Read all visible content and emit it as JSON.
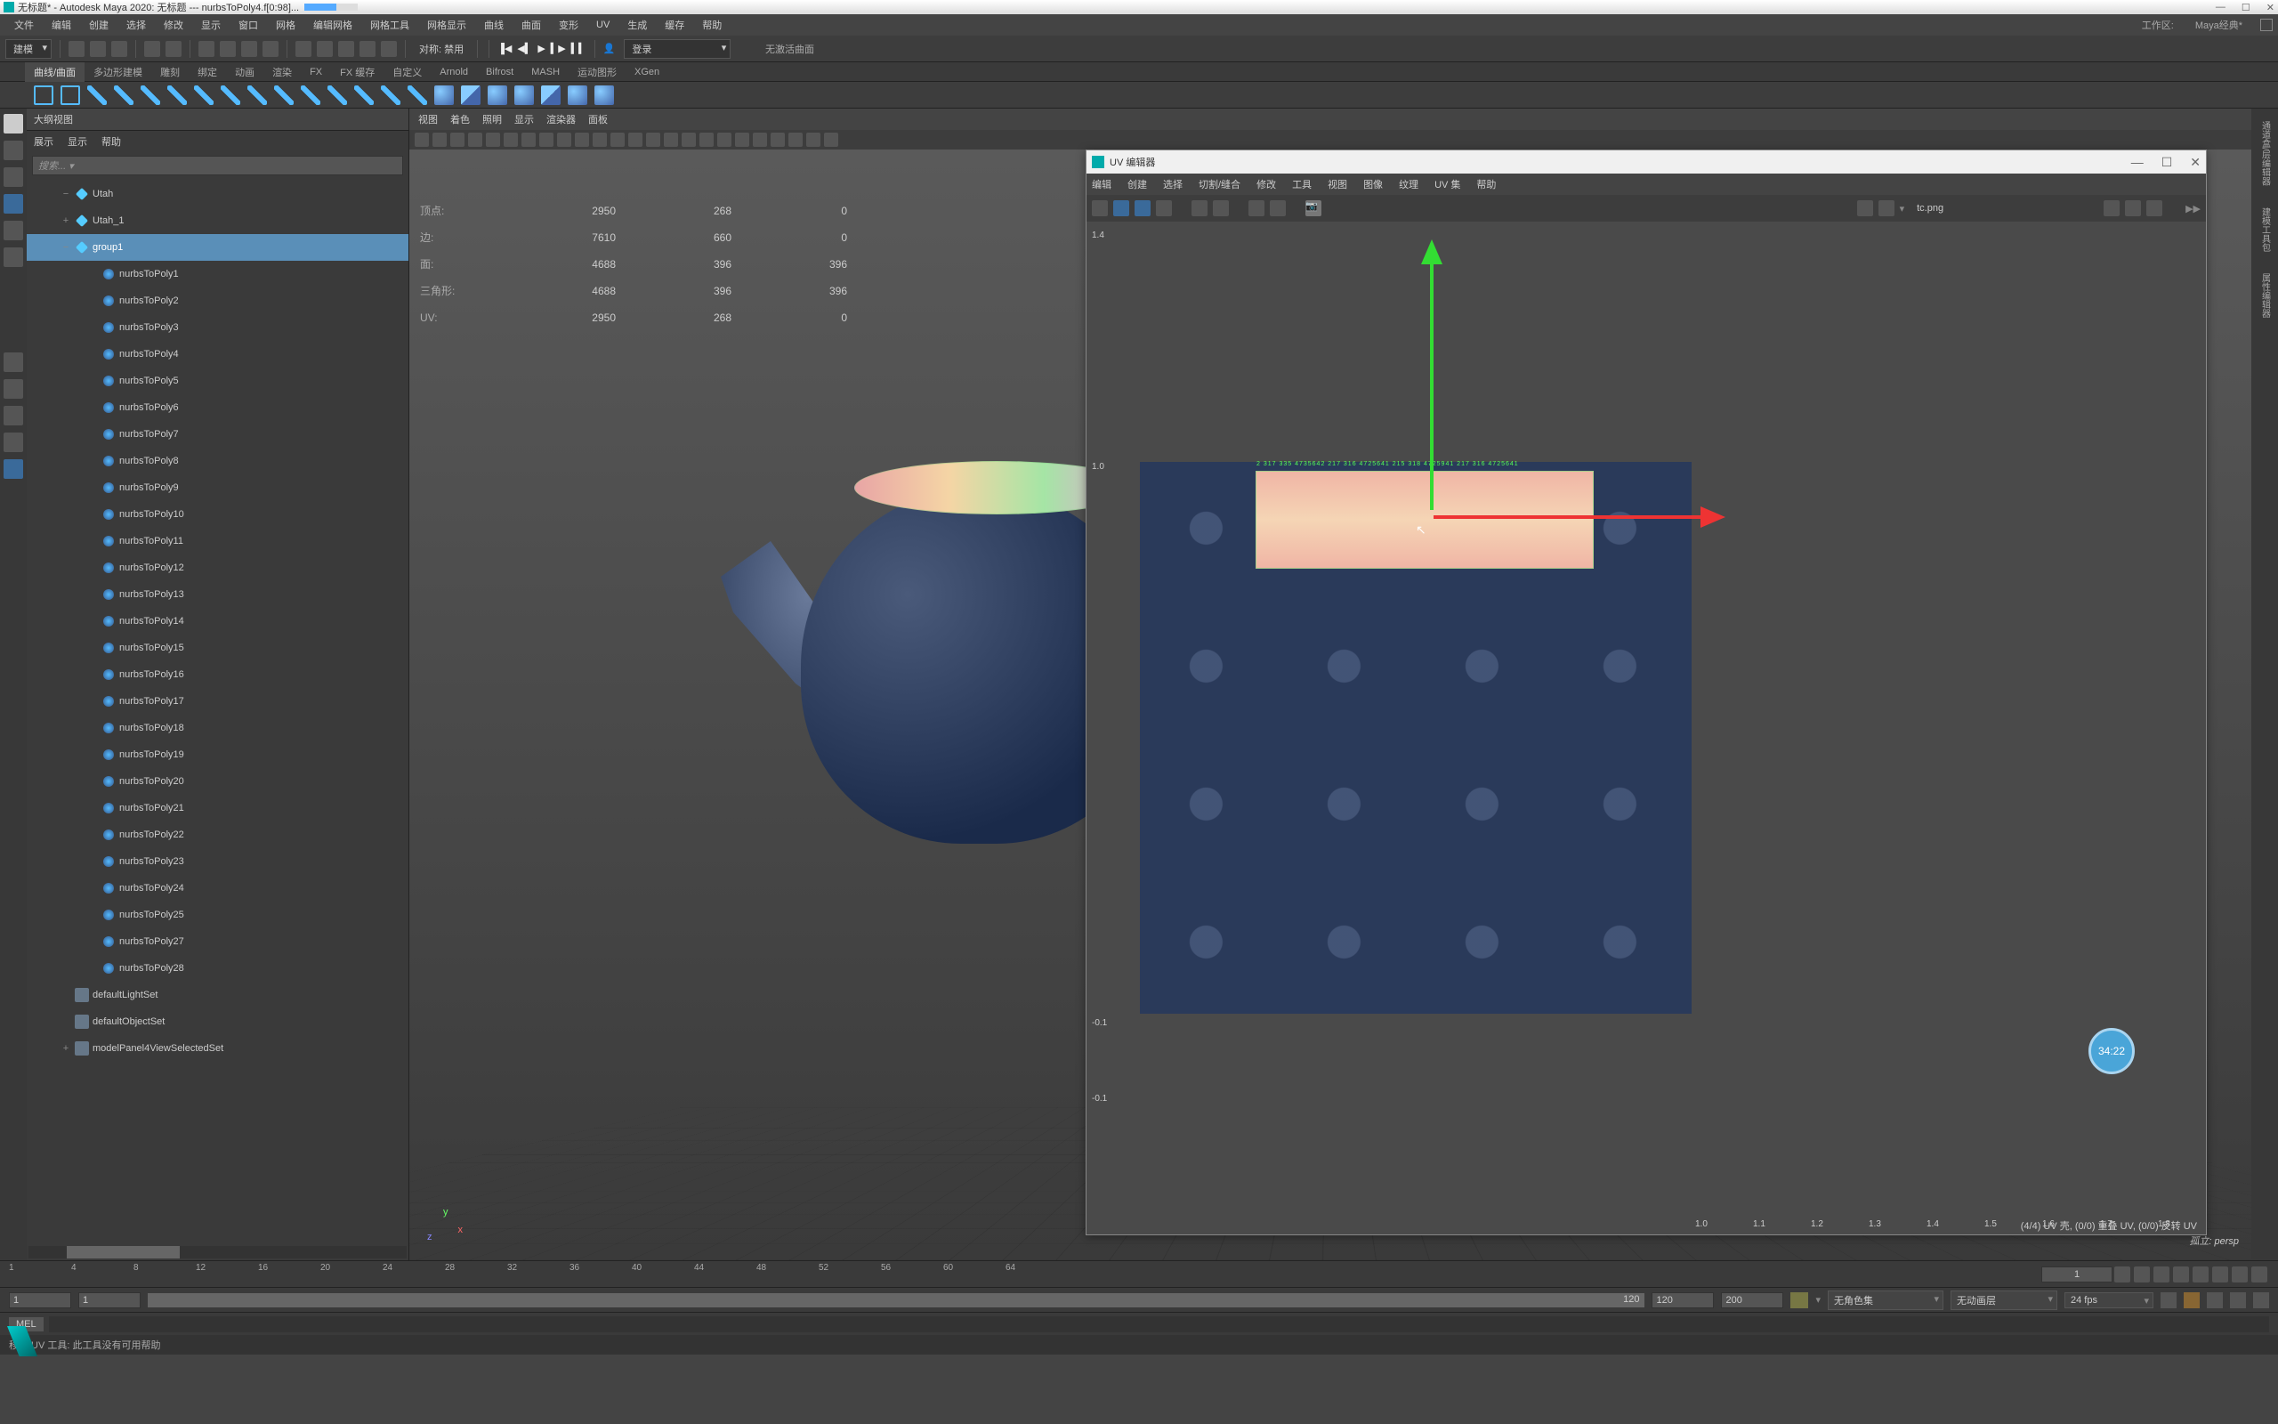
{
  "title": "无标题* - Autodesk Maya 2020: 无标题 --- nurbsToPoly4.f[0:98]...",
  "window_buttons": [
    "—",
    "☐",
    "✕"
  ],
  "workspace_label": "工作区:",
  "workspace_value": "Maya经典*",
  "menubar": [
    "文件",
    "编辑",
    "创建",
    "选择",
    "修改",
    "显示",
    "窗口",
    "网格",
    "编辑网格",
    "网格工具",
    "网格显示",
    "曲线",
    "曲面",
    "变形",
    "UV",
    "生成",
    "缓存",
    "帮助"
  ],
  "shelf_dropdown": "建模",
  "shelf_symmetry_label": "对称: 禁用",
  "shelf_login": "登录",
  "shelf_tabs": [
    "曲线/曲面",
    "多边形建模",
    "雕刻",
    "绑定",
    "动画",
    "渲染",
    "FX",
    "FX 缓存",
    "自定义",
    "Arnold",
    "Bifrost",
    "MASH",
    "运动图形",
    "XGen"
  ],
  "outliner": {
    "title": "大纲视图",
    "menu": [
      "展示",
      "显示",
      "帮助"
    ],
    "search_placeholder": "搜索...",
    "items": [
      {
        "indent": 1,
        "icon": "diamond",
        "label": "Utah",
        "exp": "−"
      },
      {
        "indent": 1,
        "icon": "diamond",
        "label": "Utah_1",
        "exp": "+"
      },
      {
        "indent": 1,
        "icon": "diamond",
        "label": "group1",
        "exp": "−",
        "selected": true
      },
      {
        "indent": 2,
        "icon": "blue",
        "label": "nurbsToPoly1"
      },
      {
        "indent": 2,
        "icon": "blue",
        "label": "nurbsToPoly2"
      },
      {
        "indent": 2,
        "icon": "blue",
        "label": "nurbsToPoly3"
      },
      {
        "indent": 2,
        "icon": "blue",
        "label": "nurbsToPoly4"
      },
      {
        "indent": 2,
        "icon": "blue",
        "label": "nurbsToPoly5"
      },
      {
        "indent": 2,
        "icon": "blue",
        "label": "nurbsToPoly6"
      },
      {
        "indent": 2,
        "icon": "blue",
        "label": "nurbsToPoly7"
      },
      {
        "indent": 2,
        "icon": "blue",
        "label": "nurbsToPoly8"
      },
      {
        "indent": 2,
        "icon": "blue",
        "label": "nurbsToPoly9"
      },
      {
        "indent": 2,
        "icon": "blue",
        "label": "nurbsToPoly10"
      },
      {
        "indent": 2,
        "icon": "blue",
        "label": "nurbsToPoly11"
      },
      {
        "indent": 2,
        "icon": "blue",
        "label": "nurbsToPoly12"
      },
      {
        "indent": 2,
        "icon": "blue",
        "label": "nurbsToPoly13"
      },
      {
        "indent": 2,
        "icon": "blue",
        "label": "nurbsToPoly14"
      },
      {
        "indent": 2,
        "icon": "blue",
        "label": "nurbsToPoly15"
      },
      {
        "indent": 2,
        "icon": "blue",
        "label": "nurbsToPoly16"
      },
      {
        "indent": 2,
        "icon": "blue",
        "label": "nurbsToPoly17"
      },
      {
        "indent": 2,
        "icon": "blue",
        "label": "nurbsToPoly18"
      },
      {
        "indent": 2,
        "icon": "blue",
        "label": "nurbsToPoly19"
      },
      {
        "indent": 2,
        "icon": "blue",
        "label": "nurbsToPoly20"
      },
      {
        "indent": 2,
        "icon": "blue",
        "label": "nurbsToPoly21"
      },
      {
        "indent": 2,
        "icon": "blue",
        "label": "nurbsToPoly22"
      },
      {
        "indent": 2,
        "icon": "blue",
        "label": "nurbsToPoly23"
      },
      {
        "indent": 2,
        "icon": "blue",
        "label": "nurbsToPoly24"
      },
      {
        "indent": 2,
        "icon": "blue",
        "label": "nurbsToPoly25"
      },
      {
        "indent": 2,
        "icon": "blue",
        "label": "nurbsToPoly27"
      },
      {
        "indent": 2,
        "icon": "blue",
        "label": "nurbsToPoly28"
      },
      {
        "indent": 1,
        "icon": "box",
        "label": "defaultLightSet"
      },
      {
        "indent": 1,
        "icon": "box",
        "label": "defaultObjectSet"
      },
      {
        "indent": 1,
        "icon": "box",
        "label": "modelPanel4ViewSelectedSet",
        "exp": "+"
      }
    ]
  },
  "viewport": {
    "menu": [
      "视图",
      "着色",
      "照明",
      "显示",
      "渲染器",
      "面板"
    ],
    "hud": [
      {
        "label": "顶点:",
        "cols": [
          "2950",
          "268",
          "0"
        ]
      },
      {
        "label": "边:",
        "cols": [
          "7610",
          "660",
          "0"
        ]
      },
      {
        "label": "面:",
        "cols": [
          "4688",
          "396",
          "396"
        ]
      },
      {
        "label": "三角形:",
        "cols": [
          "4688",
          "396",
          "396"
        ]
      },
      {
        "label": "UV:",
        "cols": [
          "2950",
          "268",
          "0"
        ]
      }
    ],
    "camera": "孤立: persp"
  },
  "uv": {
    "title": "UV 编辑器",
    "menu": [
      "编辑",
      "创建",
      "选择",
      "切割/缝合",
      "修改",
      "工具",
      "视图",
      "图像",
      "纹理",
      "UV 集",
      "帮助"
    ],
    "texture_name": "tc.png",
    "ruler_y": [
      "1.4",
      "1.0",
      "-0.1",
      "-0.1"
    ],
    "ruler_x": [
      "1.0",
      "1.1",
      "1.2",
      "1.3",
      "1.4",
      "1.5",
      "1.6",
      "1.7",
      "1.8"
    ],
    "status": "(4/4) UV 壳, (0/0) 重叠 UV, (0/0) 反转 UV",
    "time_badge": "34:22"
  },
  "range": {
    "start_outer": "1",
    "start_inner": "1",
    "end_inner": "120",
    "end_outer": "120",
    "step": "200",
    "charset": "无角色集",
    "layer": "无动画层",
    "fps": "24 fps",
    "current_frame": "1"
  },
  "timeline_marks": [
    "1",
    "4",
    "8",
    "12",
    "16",
    "20",
    "24",
    "28",
    "32",
    "36",
    "40",
    "44",
    "48",
    "52",
    "56",
    "60",
    "64"
  ],
  "cmd_label": "MEL",
  "status_text": "移动 UV 工具: 此工具没有可用帮助",
  "noactive": "无激活曲面"
}
